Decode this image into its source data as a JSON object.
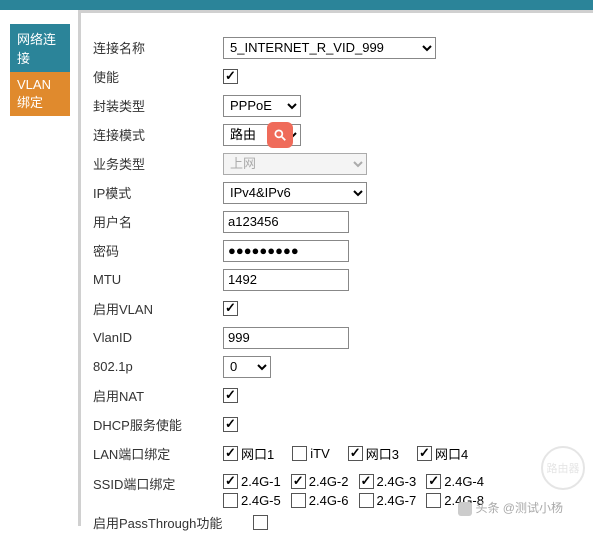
{
  "sidebar": {
    "items": [
      {
        "label": "网络连接"
      },
      {
        "label": "VLAN绑定"
      }
    ]
  },
  "form": {
    "conn_name_label": "连接名称",
    "conn_name_value": "5_INTERNET_R_VID_999",
    "enable_label": "使能",
    "enable_checked": true,
    "encap_label": "封装类型",
    "encap_value": "PPPoE",
    "mode_label": "连接模式",
    "mode_value": "路由",
    "service_label": "业务类型",
    "service_value": "上网",
    "ip_mode_label": "IP模式",
    "ip_mode_value": "IPv4&IPv6",
    "user_label": "用户名",
    "user_value": "a123456",
    "pwd_label": "密码",
    "pwd_value": "●●●●●●●●●",
    "mtu_label": "MTU",
    "mtu_value": "1492",
    "vlan_en_label": "启用VLAN",
    "vlan_en_checked": true,
    "vlanid_label": "VlanID",
    "vlanid_value": "999",
    "p8021_label": "802.1p",
    "p8021_value": "0",
    "nat_label": "启用NAT",
    "nat_checked": true,
    "dhcp_label": "DHCP服务使能",
    "dhcp_checked": true,
    "lan_label": "LAN端口绑定",
    "lan_ports": [
      {
        "label": "网口1",
        "checked": true
      },
      {
        "label": "iTV",
        "checked": false
      },
      {
        "label": "网口3",
        "checked": true
      },
      {
        "label": "网口4",
        "checked": true
      }
    ],
    "ssid_label": "SSID端口绑定",
    "ssid_ports_row1": [
      {
        "label": "2.4G-1",
        "checked": true
      },
      {
        "label": "2.4G-2",
        "checked": true
      },
      {
        "label": "2.4G-3",
        "checked": true
      },
      {
        "label": "2.4G-4",
        "checked": true
      }
    ],
    "ssid_ports_row2": [
      {
        "label": "2.4G-5",
        "checked": false
      },
      {
        "label": "2.4G-6",
        "checked": false
      },
      {
        "label": "2.4G-7",
        "checked": false
      },
      {
        "label": "2.4G-8",
        "checked": false
      }
    ],
    "passthrough_label": "启用PassThrough功能",
    "passthrough_checked": false
  },
  "watermark_text": "路由器",
  "attribution": "头条 @测试小杨"
}
